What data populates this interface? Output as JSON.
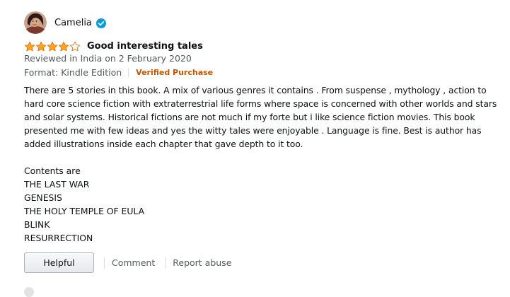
{
  "review": {
    "reviewer": {
      "name": "Camelia",
      "avatar_icon": "user-avatar-photo",
      "badge_icon": "verified-check-icon",
      "badge_color": "#0a9bd9"
    },
    "rating": {
      "stars": 4,
      "out_of": 5,
      "star_color": "#ffa41c"
    },
    "title": "Good interesting tales",
    "date": "Reviewed in India on 2 February 2020",
    "format": "Format: Kindle Edition",
    "verified_purchase": "Verified Purchase",
    "verified_color": "#c45500",
    "body_paragraph": "There are 5 stories in this book. A mix of various genres it contains . From suspense , mythology , action to hard core science fiction with extraterrestrial life forms where space is concerned with other worlds and stars and solar systems. Historical fictions are not much if my forte but i like science fiction movies. This book presented me with few ideas and yes the witty tales were enjoyable . Language is fine. Best is author has added illustrations inside each chapter that gave depth to it too.",
    "contents_heading": "Contents are",
    "contents": [
      "THE LAST WAR",
      "GENESIS",
      "THE HOLY TEMPLE OF EULA",
      "BLINK",
      "RESURRECTION"
    ]
  },
  "actions": {
    "helpful_label": "Helpful",
    "comment_label": "Comment",
    "report_label": "Report abuse"
  }
}
